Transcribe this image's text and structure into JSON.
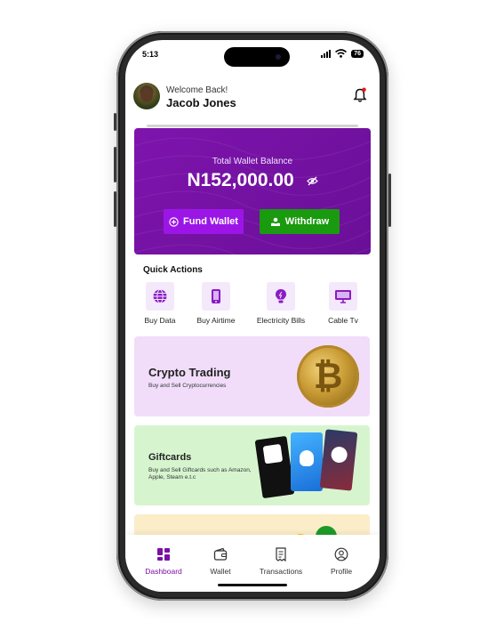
{
  "status_bar": {
    "time": "5:13",
    "battery": "76"
  },
  "header": {
    "welcome": "Welcome Back!",
    "username": "Jacob Jones"
  },
  "wallet": {
    "caption": "Total Wallet Balance",
    "amount": "N152,000.00",
    "fund_label": "Fund Wallet",
    "withdraw_label": "Withdraw",
    "colors": {
      "card": "#7e14ad",
      "fund": "#9b16e6",
      "withdraw": "#1a9a0f"
    }
  },
  "quick_actions": {
    "title": "Quick Actions",
    "items": [
      {
        "label": "Buy Data",
        "icon": "globe-icon"
      },
      {
        "label": "Buy Airtime",
        "icon": "phone-icon"
      },
      {
        "label": "Electricity Bills",
        "icon": "bulb-icon"
      },
      {
        "label": "Cable Tv",
        "icon": "tv-icon"
      }
    ]
  },
  "cards": {
    "crypto": {
      "title": "Crypto Trading",
      "subtitle": "Buy and Sell Cryptocurrencies",
      "coin_symbol": "₿"
    },
    "giftcards": {
      "title": "Giftcards",
      "subtitle": "Buy and Sell Giftcards such as Amazon, Apple, Steam e.t.c"
    }
  },
  "nav": {
    "items": [
      {
        "label": "Dashboard",
        "icon": "dashboard-icon",
        "active": true
      },
      {
        "label": "Wallet",
        "icon": "wallet-icon",
        "active": false
      },
      {
        "label": "Transactions",
        "icon": "receipt-icon",
        "active": false
      },
      {
        "label": "Profile",
        "icon": "profile-icon",
        "active": false
      }
    ],
    "active_color": "#7b0fa6"
  }
}
